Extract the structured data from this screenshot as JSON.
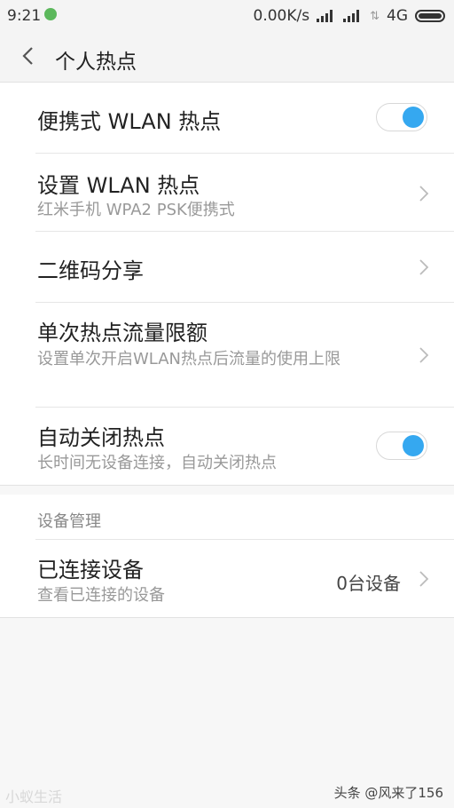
{
  "status_bar": {
    "time": "9:21",
    "net_speed": "0.00K/s",
    "network": "4G"
  },
  "header": {
    "title": "个人热点"
  },
  "settings": {
    "portable_hotspot": {
      "label": "便携式 WLAN 热点",
      "enabled": true
    },
    "setup_hotspot": {
      "label": "设置 WLAN 热点",
      "sub": "红米手机 WPA2 PSK便携式"
    },
    "qr_share": {
      "label": "二维码分享"
    },
    "data_limit": {
      "label": "单次热点流量限额",
      "sub": "设置单次开启WLAN热点后流量的使用上限"
    },
    "auto_off": {
      "label": "自动关闭热点",
      "sub": "长时间无设备连接，自动关闭热点",
      "enabled": true
    }
  },
  "device_management": {
    "header": "设备管理",
    "connected": {
      "label": "已连接设备",
      "sub": "查看已连接的设备",
      "value": "0台设备"
    }
  },
  "watermarks": {
    "left": "小蚁生活",
    "right": "头条 @风来了156"
  },
  "colors": {
    "accent": "#35a8f0",
    "background": "#f7f7f7"
  }
}
